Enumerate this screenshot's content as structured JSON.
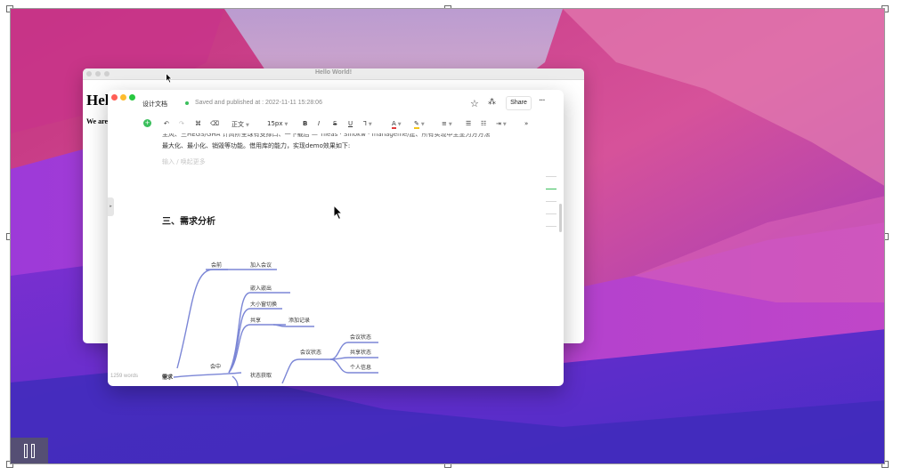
{
  "back_window": {
    "title": "Hello World!",
    "heading": "Hel",
    "text": "We are"
  },
  "editor": {
    "doc_name": "设计文档",
    "save_status": "Saved and published at : 2022-11-11 15:28:06",
    "share_label": "Share",
    "toolbar": {
      "style_value": "正文",
      "font_size": "15px",
      "bold": "B",
      "italic": "I",
      "strike": "S",
      "underline": "U",
      "font_color": "A"
    },
    "body_line_1": "主风、三HEGS/GHA 计高阶全球有支撑口、一下载后 — Tileas · Sinokw · manageme/建、所有实现中主显为方方法",
    "body_line_2": "最大化、最小化、销毁等功能。借用库的能力，实现demo效果如下:",
    "placeholder": "输入 / 唤起更多",
    "section_heading": "三、需求分析",
    "word_count": "1259 words"
  },
  "mindmap": {
    "root": "需求",
    "nodes": {
      "before": "会前",
      "join": "加入会议",
      "embed": "嵌入嵌出",
      "resize": "大小窗切换",
      "share": "共享",
      "record": "添加记录",
      "during": "会中",
      "meeting_state": "会议状态",
      "state_fetch": "状态获取",
      "meeting_status": "会议状态",
      "share_status": "共享状态",
      "personal_info": "个人信息"
    }
  },
  "colors": {
    "accent_green": "#3bbf5c",
    "mindmap_line": "#7b86d6",
    "close_dot": "#ff5f57",
    "min_dot": "#febc2e",
    "max_dot": "#28c840"
  },
  "icons": [
    "undo-icon",
    "redo-icon",
    "format-painter-icon",
    "eraser-icon",
    "star-icon",
    "collab-icon",
    "more-icon",
    "pause-icon",
    "cursor-icon"
  ]
}
